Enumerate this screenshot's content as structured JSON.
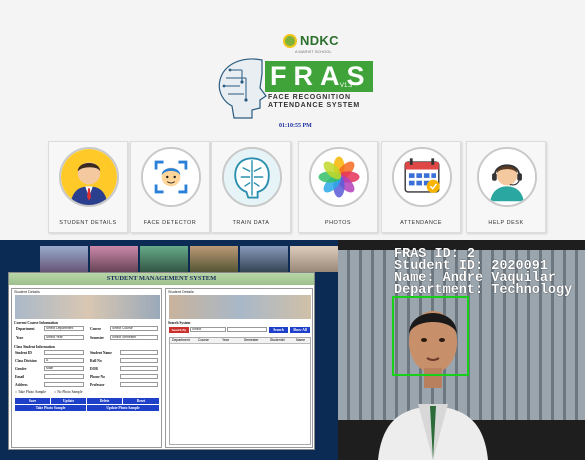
{
  "app": {
    "brand": "NDKC",
    "tagline": "A MARIST SCHOOL",
    "title": "FRAS",
    "version": "V1.3",
    "subtitle_line1": "FACE RECOGNITION",
    "subtitle_line2": "ATTENDANCE SYSTEM",
    "clock": "01:10:55 PM",
    "accent_color": "#3fa33a"
  },
  "tiles": [
    {
      "label": "STUDENT DETAILS",
      "icon": "student-icon"
    },
    {
      "label": "FACE DETECTOR",
      "icon": "face-scan-icon"
    },
    {
      "label": "TRAIN DATA",
      "icon": "brain-circuit-icon"
    },
    {
      "label": "PHOTOS",
      "icon": "photos-icon"
    },
    {
      "label": "ATTENDANCE",
      "icon": "calendar-icon"
    },
    {
      "label": "HELP DESK",
      "icon": "support-agent-icon"
    }
  ],
  "sms": {
    "title": "STUDENT MANAGEMENT SYSTEM",
    "left_pane_title": "Student Details",
    "right_pane_title": "Student Details",
    "current_course": "Current Course Information",
    "department_label": "Department",
    "department_value": "Select Department",
    "course_label": "Course",
    "course_value": "Select Course",
    "year_label": "Year",
    "year_value": "Select Year",
    "semester_label": "Semester",
    "semester_value": "Select Semester",
    "class_info": "Class Student Information",
    "student_id_label": "Student ID",
    "student_name_label": "Student Name",
    "class_division_label": "Class Division",
    "class_division_value": "A",
    "roll_label": "Roll No",
    "gender_label": "Gender",
    "gender_value": "Male",
    "dob_label": "DOB",
    "email_label": "Email",
    "phone_label": "Phone No",
    "address_label": "Address",
    "professor_label": "Professor",
    "take_photo_radio": "Take Photo Sample",
    "no_photo_radio": "No Photo Sample",
    "save_btn": "Save",
    "update_btn": "Update",
    "delete_btn": "Delete",
    "reset_btn": "Reset",
    "take_photo_btn": "Take Photo Sample",
    "update_photo_btn": "Update Photo Sample",
    "search_title": "Search System",
    "search_by": "Search By",
    "search_select": "Select",
    "search_btn": "Search",
    "show_all_btn": "Show All",
    "columns": [
      "Department",
      "Course",
      "Year",
      "Semester",
      "StudentId",
      "Name"
    ]
  },
  "camera": {
    "line1": "FRAS ID: 2",
    "line2": "Student ID: 2020091",
    "line3": "Name: Andre Vaquilar",
    "line4": "Department: Technology",
    "box_color": "#18d018"
  }
}
